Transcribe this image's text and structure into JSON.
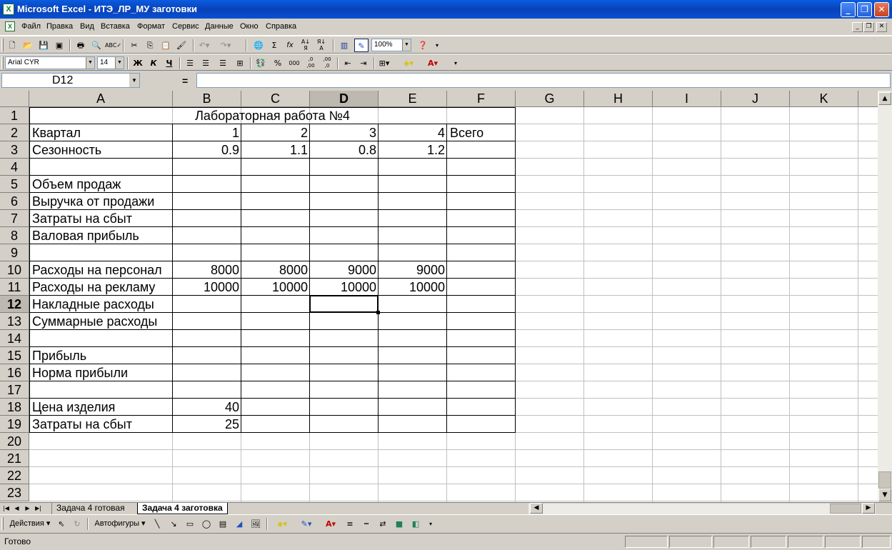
{
  "window": {
    "title": "Microsoft Excel - ИТЭ_ЛР_МУ заготовки",
    "app_icon": "excel-icon"
  },
  "menu": [
    "Файл",
    "Правка",
    "Вид",
    "Вставка",
    "Формат",
    "Сервис",
    "Данные",
    "Окно",
    "Справка"
  ],
  "toolbar": {
    "zoom": "100%",
    "font_name": "Arial CYR",
    "font_size": "14",
    "bold_label": "Ж",
    "italic_label": "К",
    "underline_label": "Ч",
    "percent_label": "%",
    "thousands_label": "000",
    "inc_decimal_label": ",0 ,00",
    "dec_decimal_label": ",00 ,0",
    "sum_label": "Σ",
    "fx_label": "fx"
  },
  "formula_bar": {
    "name_box": "D12",
    "equals": "=",
    "formula": ""
  },
  "grid": {
    "columns": [
      "A",
      "B",
      "C",
      "D",
      "E",
      "F",
      "G",
      "H",
      "I",
      "J",
      "K"
    ],
    "rows": [
      "1",
      "2",
      "3",
      "4",
      "5",
      "6",
      "7",
      "8",
      "9",
      "10",
      "11",
      "12",
      "13",
      "14",
      "15",
      "16",
      "17",
      "18",
      "19",
      "20",
      "21",
      "22",
      "23"
    ],
    "selected_column": "D",
    "selected_row": "12",
    "title": "Лабораторная работа №4",
    "header_row": {
      "label": "Квартал",
      "q1": "1",
      "q2": "2",
      "q3": "3",
      "q4": "4",
      "total": "Всего"
    },
    "season_row": {
      "label": "Сезонность",
      "q1": "0.9",
      "q2": "1.1",
      "q3": "0.8",
      "q4": "1.2"
    },
    "labels": {
      "r5": "Объем продаж",
      "r6": "Выручка от продажи",
      "r7": "Затраты на сбыт",
      "r8": "Валовая прибыль",
      "r10": "Расходы на персонал",
      "r11": "Расходы на рекламу",
      "r12": "Накладные расходы",
      "r13": "Суммарные расходы",
      "r15": "Прибыль",
      "r16": "Норма прибыли",
      "r18": "Цена изделия",
      "r19": "Затраты на сбыт"
    },
    "personnel": [
      "8000",
      "8000",
      "9000",
      "9000"
    ],
    "advertising": [
      "10000",
      "10000",
      "10000",
      "10000"
    ],
    "price": "40",
    "sales_cost": "25"
  },
  "sheet_tabs": [
    "Задача 4 готовая",
    "Задача 4 заготовка"
  ],
  "active_tab": "Задача 4 заготовка",
  "drawing_toolbar": {
    "actions": "Действия",
    "autoshapes": "Автофигуры"
  },
  "status": {
    "text": "Готово"
  }
}
